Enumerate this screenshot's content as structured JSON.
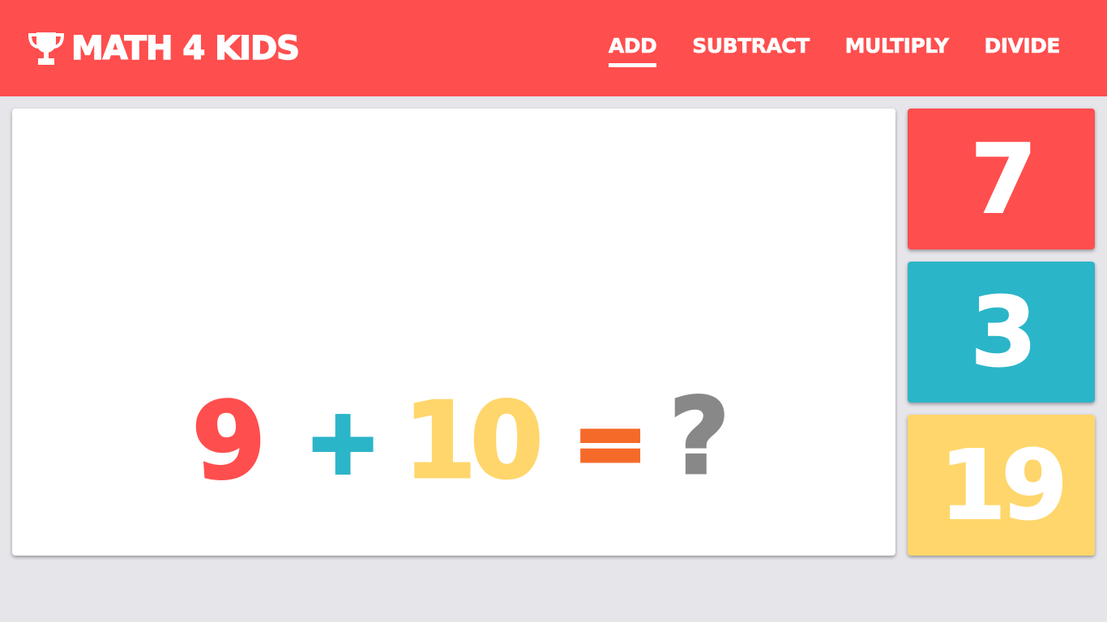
{
  "header": {
    "brand": "MATH 4 KIDS",
    "brand_icon": "trophy-icon",
    "background": "#ff4e4e",
    "nav": [
      {
        "label": "ADD",
        "active": true
      },
      {
        "label": "SUBTRACT",
        "active": false
      },
      {
        "label": "MULTIPLY",
        "active": false
      },
      {
        "label": "DIVIDE",
        "active": false
      }
    ]
  },
  "question": {
    "operand_a": "9",
    "operator": "+",
    "operand_b": "10",
    "equals": "=",
    "unknown": "?",
    "colors": {
      "operand_a": "#ff4e4e",
      "operator": "#2bb5c9",
      "operand_b": "#ffd66b",
      "equals": "#f56a29",
      "unknown": "#888888"
    }
  },
  "answers": [
    {
      "label": "7",
      "color": "#ff4e4e"
    },
    {
      "label": "3",
      "color": "#2bb5c9"
    },
    {
      "label": "19",
      "color": "#ffd66b"
    }
  ]
}
